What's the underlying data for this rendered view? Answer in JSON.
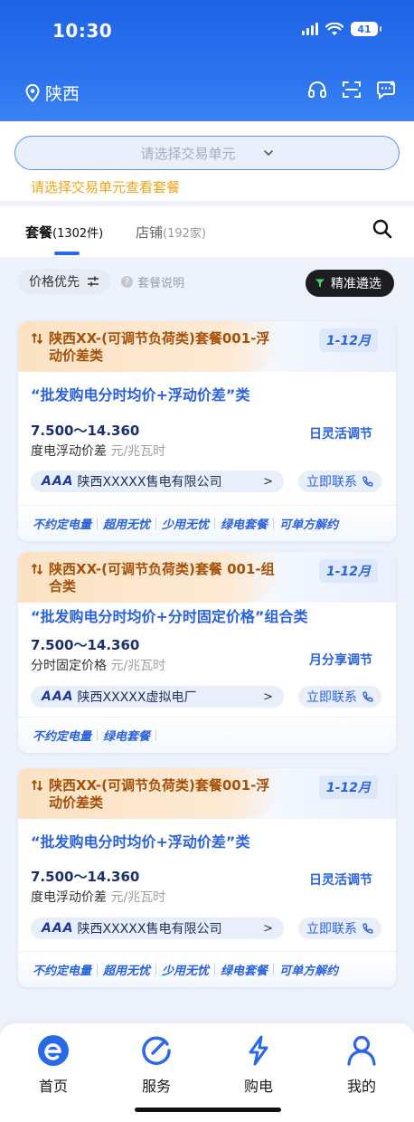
{
  "status_bar": {
    "time": "10:30",
    "battery": "41"
  },
  "header": {
    "location": "陕西"
  },
  "unit_selector": {
    "placeholder": "请选择交易单元",
    "hint": "请选择交易单元查看套餐"
  },
  "tabs": [
    {
      "label": "套餐",
      "count": "(1302件)"
    },
    {
      "label": "店铺",
      "count": "(192家)"
    }
  ],
  "filters": {
    "sort": "价格优先",
    "info": "套餐说明",
    "pick": "精准遴选"
  },
  "packages": [
    {
      "name": "陕西XX-(可调节负荷类)套餐001-浮动价差类",
      "months": "1-12月",
      "title": "“批发购电分时均价+浮动价差”类",
      "price": "7.500～14.360",
      "price_label": "度电浮动价差",
      "unit": "元/兆瓦时",
      "regulation": "日灵活调节",
      "company_badge": "AAA",
      "company": "陕西XXXXX售电有限公司",
      "contact": "立即联系",
      "tags": [
        "不约定电量",
        "超用无忧",
        "少用无忧",
        "绿电套餐",
        "可单方解约"
      ]
    },
    {
      "name": "陕西XX-(可调节负荷类)套餐 001-组合类",
      "months": "1-12月",
      "title": "“批发购电分时均价+分时固定价格”组合类",
      "price": "7.500～14.360",
      "price_label": "分时固定价格",
      "unit": "元/兆瓦时",
      "regulation": "月分享调节",
      "company_badge": "AAA",
      "company": "陕西XXXXX虚拟电厂",
      "contact": "立即联系",
      "tags": [
        "不约定电量",
        "绿电套餐"
      ]
    },
    {
      "name": "陕西XX-(可调节负荷类)套餐001-浮动价差类",
      "months": "1-12月",
      "title": "“批发购电分时均价+浮动价差”类",
      "price": "7.500～14.360",
      "price_label": "度电浮动价差",
      "unit": "元/兆瓦时",
      "regulation": "日灵活调节",
      "company_badge": "AAA",
      "company": "陕西XXXXX售电有限公司",
      "contact": "立即联系",
      "tags": [
        "不约定电量",
        "超用无忧",
        "少用无忧",
        "绿电套餐",
        "可单方解约"
      ]
    }
  ],
  "bottom_nav": [
    {
      "label": "首页",
      "icon": "home-e-icon"
    },
    {
      "label": "服务",
      "icon": "service-gauge-icon"
    },
    {
      "label": "购电",
      "icon": "lightning-icon"
    },
    {
      "label": "我的",
      "icon": "user-icon"
    }
  ],
  "colors": {
    "primary": "#2a68ea",
    "accent_orange": "#f2a417",
    "ribbon_text": "#a6510a"
  }
}
